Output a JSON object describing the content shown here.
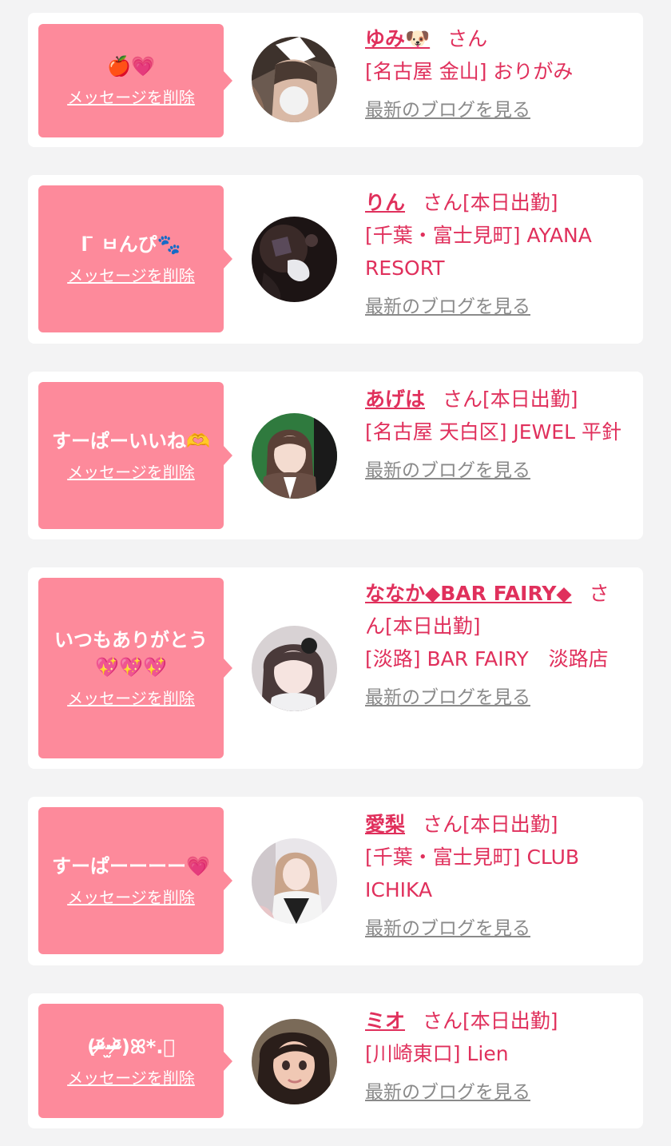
{
  "delete_label": "メッセージを削除",
  "blog_label": "最新のブログを見る",
  "cards": [
    {
      "message": "🍎💗",
      "name": "ゆみ🐶",
      "suffix": "さん",
      "status": "",
      "shop": "[名古屋 金山] おりがみ"
    },
    {
      "message": "l ̄ ㅂんぴ🐾",
      "name": "りん",
      "suffix": "さん",
      "status": "[本日出勤]",
      "shop": "[千葉・富士見町] AYANA RESORT"
    },
    {
      "message": "すーぱーいいね🫶",
      "name": "あげは",
      "suffix": "さん",
      "status": "[本日出勤]",
      "shop": "[名古屋 天白区] JEWEL 平針"
    },
    {
      "message": "いつもありがとう\n💖💖💖",
      "name": "ななか◆BAR FAIRY◆",
      "suffix": "さん",
      "status": "[本日出勤]",
      "shop": "[淡路] BAR FAIRY　淡路店"
    },
    {
      "message": "すーぱーーーー💗",
      "name": "愛梨",
      "suffix": "さん",
      "status": "[本日出勤]",
      "shop": "[千葉・富士見町] CLUB ICHIKA"
    },
    {
      "message": "(ᵒ̴̶̷᷄‧̫ᵒ̴̶̷᷅)ꕤ*.゚",
      "name": "ミオ",
      "suffix": "さん",
      "status": "[本日出勤]",
      "shop": "[川崎東口] Lien"
    }
  ]
}
